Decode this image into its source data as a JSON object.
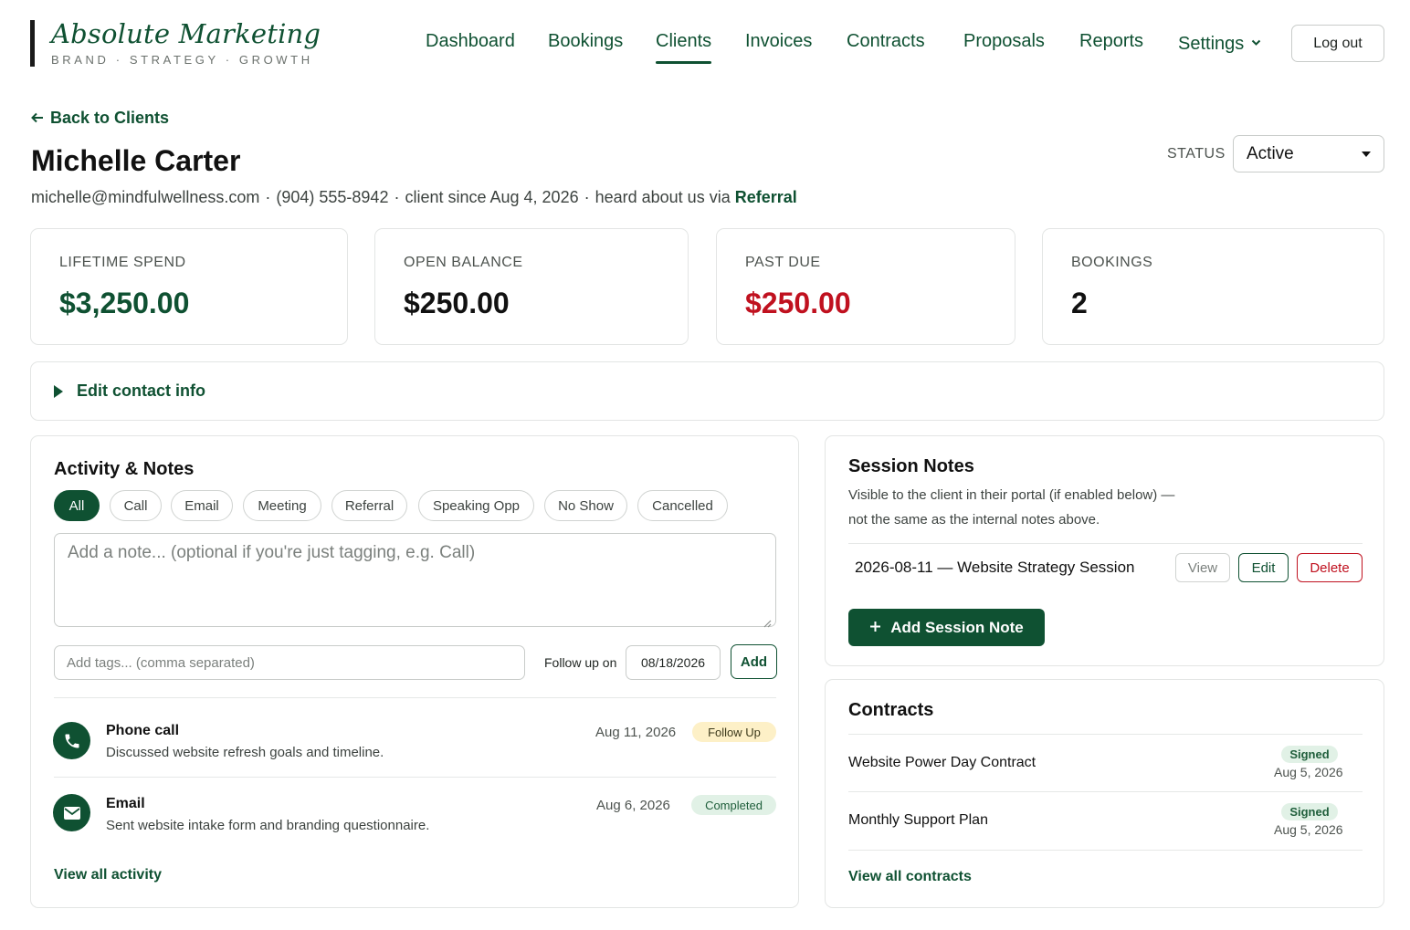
{
  "brand": {
    "title": "Absolute Marketing",
    "tagline": "BRAND · STRATEGY · GROWTH"
  },
  "nav": {
    "items": [
      {
        "label": "Dashboard"
      },
      {
        "label": "Bookings"
      },
      {
        "label": "Clients",
        "active": true
      },
      {
        "label": "Invoices"
      },
      {
        "label": "Contracts"
      },
      {
        "label": "Proposals"
      },
      {
        "label": "Reports"
      },
      {
        "label": "Settings"
      }
    ],
    "logout": "Log out"
  },
  "client": {
    "back": "Back to Clients",
    "name": "Michelle Carter",
    "email": "michelle@mindfulwellness.com",
    "phone": "(904) 555-8942",
    "since": "client since Aug 4, 2026",
    "heard_prefix": "heard about us via",
    "heard_source": "Referral",
    "status_label": "STATUS",
    "status_value": "Active"
  },
  "stats": [
    {
      "label": "LIFETIME SPEND",
      "value": "$3,250.00",
      "color": "#0f5132"
    },
    {
      "label": "OPEN BALANCE",
      "value": "$250.00",
      "color": "#111111"
    },
    {
      "label": "PAST DUE",
      "value": "$250.00",
      "color": "#c0111f"
    },
    {
      "label": "BOOKINGS",
      "value": "2",
      "color": "#111111"
    }
  ],
  "edit_contact": "Edit contact info",
  "activity": {
    "title": "Activity & Notes",
    "filters": [
      "All",
      "Call",
      "Email",
      "Meeting",
      "Referral",
      "Speaking Opp",
      "No Show",
      "Cancelled"
    ],
    "note_placeholder": "Add a note... (optional if you're just tagging, e.g. Call)",
    "tags_placeholder": "Add tags... (comma separated)",
    "follow_label": "Follow up on",
    "follow_date": "08/18/2026",
    "add": "Add",
    "items": [
      {
        "icon": "phone-icon",
        "title": "Phone call",
        "desc": "Discussed website refresh goals and timeline.",
        "date": "Aug 11, 2026",
        "badge": "Follow Up"
      },
      {
        "icon": "mail-icon",
        "title": "Email",
        "desc": "Sent website intake form and branding questionnaire.",
        "date": "Aug 6, 2026",
        "badge": "Completed"
      }
    ],
    "view_all": "View all activity"
  },
  "session_notes": {
    "title": "Session Notes",
    "desc1": "Visible to the client in their portal (if enabled below) —",
    "desc2": "not the same as the internal notes above.",
    "entry": "2026-08-11 — Website Strategy Session",
    "view": "View",
    "edit": "Edit",
    "delete": "Delete",
    "add": "Add Session Note"
  },
  "contracts": {
    "title": "Contracts",
    "items": [
      {
        "name": "Website Power Day Contract",
        "status": "Signed",
        "date": "Aug 5, 2026"
      },
      {
        "name": "Monthly Support Plan",
        "status": "Signed",
        "date": "Aug 5, 2026"
      }
    ],
    "view_all": "View all contracts"
  },
  "colors": {
    "brand_green": "#0f5132",
    "past_due_red": "#c0111f",
    "follow_up_badge": "#fdf0c7",
    "completed_badge": "#e1f1e6"
  }
}
